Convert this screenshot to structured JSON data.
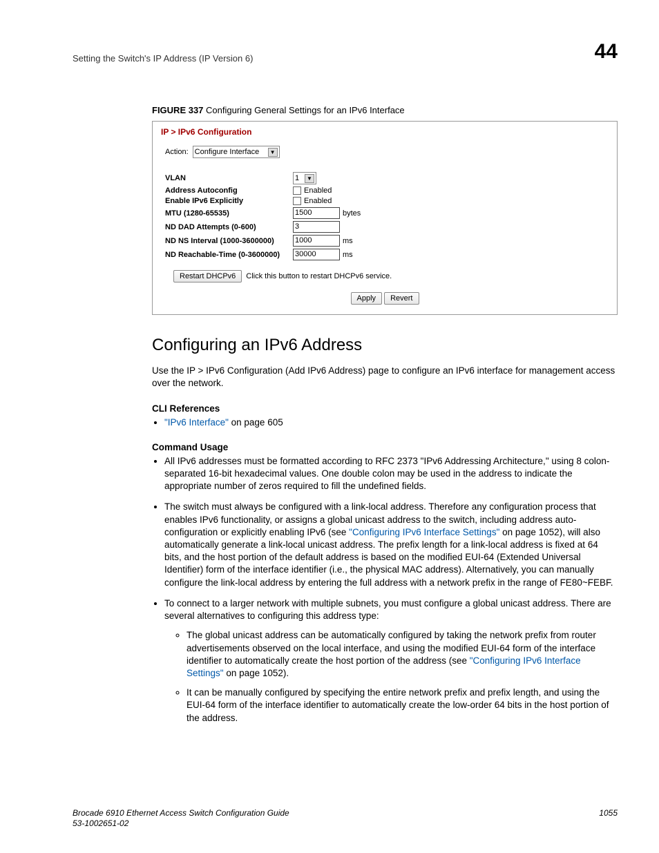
{
  "header": {
    "running_head": "Setting the Switch's IP Address (IP Version 6)",
    "chapter_number": "44"
  },
  "figure": {
    "label": "FIGURE 337",
    "caption": "Configuring General Settings for an IPv6 Interface"
  },
  "screenshot": {
    "breadcrumb": "IP > IPv6 Configuration",
    "action_label": "Action:",
    "action_value": "Configure Interface",
    "rows": {
      "vlan": {
        "label": "VLAN",
        "value": "1"
      },
      "autoconf": {
        "label": "Address Autoconfig",
        "suffix": "Enabled"
      },
      "explicit": {
        "label": "Enable IPv6 Explicitly",
        "suffix": "Enabled"
      },
      "mtu": {
        "label": "MTU (1280-65535)",
        "value": "1500",
        "suffix": "bytes"
      },
      "dad": {
        "label": "ND DAD Attempts (0-600)",
        "value": "3"
      },
      "ns": {
        "label": "ND NS Interval (1000-3600000)",
        "value": "1000",
        "suffix": "ms"
      },
      "reach": {
        "label": "ND Reachable-Time (0-3600000)",
        "value": "30000",
        "suffix": "ms"
      }
    },
    "restart_btn": "Restart DHCPv6",
    "restart_hint": "Click this button to restart DHCPv6 service.",
    "apply_btn": "Apply",
    "revert_btn": "Revert"
  },
  "section": {
    "title": "Configuring an IPv6 Address",
    "intro": "Use the IP > IPv6 Configuration (Add IPv6 Address) page to configure an IPv6 interface for management access over the network.",
    "cli_head": "CLI References",
    "cli_link": "\"IPv6 Interface\"",
    "cli_page": " on page 605",
    "usage_head": "Command Usage",
    "bullet1": "All IPv6 addresses must be formatted according to RFC 2373 \"IPv6 Addressing Architecture,\" using 8 colon-separated 16-bit hexadecimal values. One double colon may be used in the address to indicate the appropriate number of zeros required to fill the undefined fields.",
    "bullet2_a": "The switch must always be configured with a link-local address. Therefore any configuration process that enables IPv6 functionality, or assigns a global unicast address to the switch, including address auto-configuration or explicitly enabling IPv6 (see ",
    "bullet2_link": "\"Configuring IPv6 Interface Settings\"",
    "bullet2_b": " on page 1052), will also automatically generate a link-local unicast address. The prefix length for a link-local address is fixed at 64 bits, and the host portion of the default address is based on the modified EUI-64 (Extended Universal Identifier) form of the interface identifier (i.e., the physical MAC address). Alternatively, you can manually configure the link-local address by entering the full address with a network prefix in the range of FE80~FEBF.",
    "bullet3": "To connect to a larger network with multiple subnets, you must configure a global unicast address. There are several alternatives to configuring this address type:",
    "bullet3a_a": "The global unicast address can be automatically configured by taking the network prefix from router advertisements observed on the local interface, and using the modified EUI-64 form of the interface identifier to automatically create the host portion of the address (see ",
    "bullet3a_link": "\"Configuring IPv6 Interface Settings\"",
    "bullet3a_b": " on page 1052).",
    "bullet3b": "It can be manually configured by specifying the entire network prefix and prefix length, and using the EUI-64 form of the interface identifier to automatically create the low-order 64 bits in the host portion of the address."
  },
  "footer": {
    "book": "Brocade 6910 Ethernet Access Switch Configuration Guide",
    "docnum": "53-1002651-02",
    "page": "1055"
  }
}
